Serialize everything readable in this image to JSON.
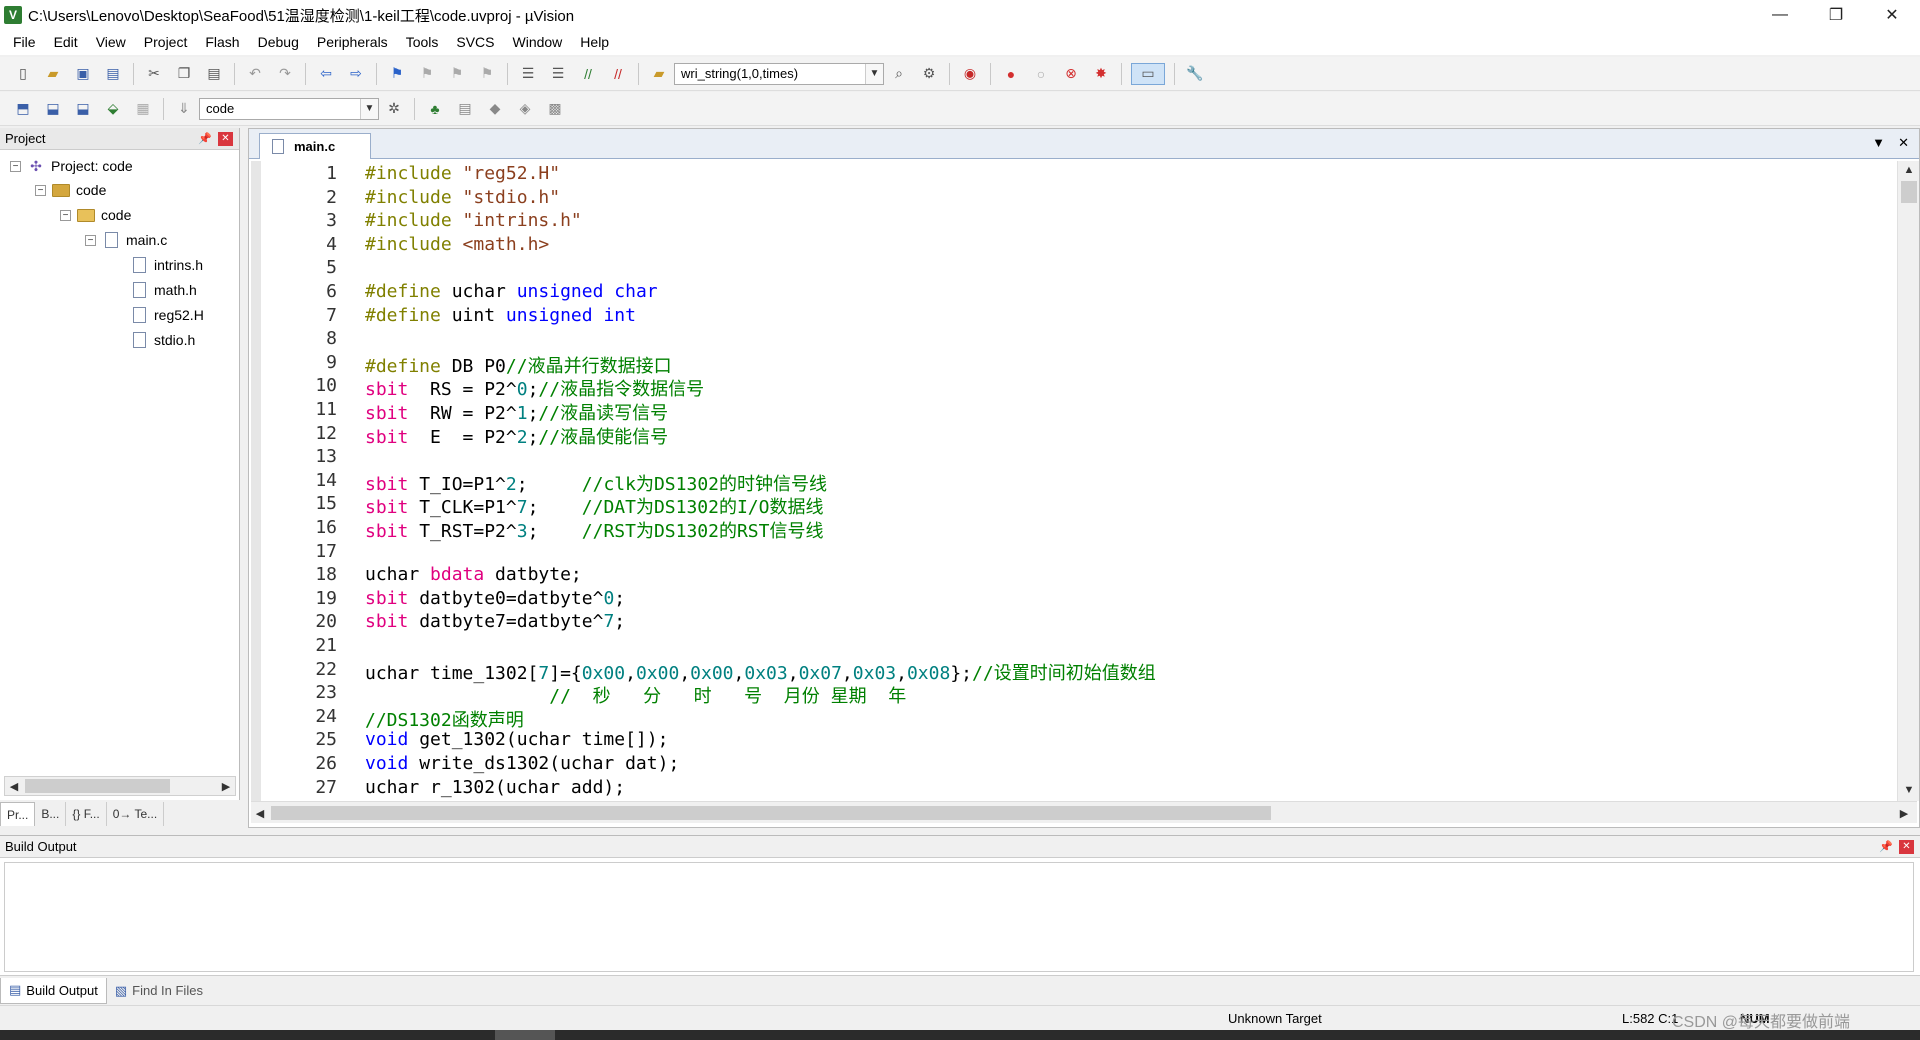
{
  "window": {
    "title": "C:\\Users\\Lenovo\\Desktop\\SeaFood\\51温湿度检测\\1-keil工程\\code.uvproj - µVision",
    "app_icon_letter": "V",
    "minimize": "—",
    "restore": "❐",
    "close": "✕"
  },
  "menu": [
    "File",
    "Edit",
    "View",
    "Project",
    "Flash",
    "Debug",
    "Peripherals",
    "Tools",
    "SVCS",
    "Window",
    "Help"
  ],
  "toolbar": {
    "find_combo_value": "wri_string(1,0,times)",
    "target_combo_value": "code"
  },
  "project_panel": {
    "title": "Project",
    "tree": [
      {
        "label": "Project: code",
        "icon": "project-icon"
      },
      {
        "label": "code",
        "icon": "target-icon"
      },
      {
        "label": "code",
        "icon": "folder-icon"
      },
      {
        "label": "main.c",
        "icon": "file-icon"
      },
      {
        "label": "intrins.h",
        "icon": "file-icon"
      },
      {
        "label": "math.h",
        "icon": "file-icon"
      },
      {
        "label": "reg52.H",
        "icon": "file-icon"
      },
      {
        "label": "stdio.h",
        "icon": "file-icon"
      }
    ],
    "tabs": [
      "Pr...",
      "B...",
      "{} F...",
      "0→ Te..."
    ]
  },
  "editor": {
    "tab_label": "main.c",
    "lines": [
      {
        "n": "1",
        "t": "#include \"reg52.H\""
      },
      {
        "n": "2",
        "t": "#include \"stdio.h\""
      },
      {
        "n": "3",
        "t": "#include \"intrins.h\""
      },
      {
        "n": "4",
        "t": "#include <math.h>"
      },
      {
        "n": "5",
        "t": ""
      },
      {
        "n": "6",
        "t": "#define uchar unsigned char"
      },
      {
        "n": "7",
        "t": "#define uint unsigned int"
      },
      {
        "n": "8",
        "t": ""
      },
      {
        "n": "9",
        "t": "#define DB P0//液晶并行数据接口"
      },
      {
        "n": "10",
        "t": "sbit  RS = P2^0;//液晶指令数据信号"
      },
      {
        "n": "11",
        "t": "sbit  RW = P2^1;//液晶读写信号"
      },
      {
        "n": "12",
        "t": "sbit  E  = P2^2;//液晶使能信号"
      },
      {
        "n": "13",
        "t": ""
      },
      {
        "n": "14",
        "t": "sbit T_IO=P1^2;     //clk为DS1302的时钟信号线"
      },
      {
        "n": "15",
        "t": "sbit T_CLK=P1^7;    //DAT为DS1302的I/O数据线"
      },
      {
        "n": "16",
        "t": "sbit T_RST=P2^3;    //RST为DS1302的RST信号线"
      },
      {
        "n": "17",
        "t": ""
      },
      {
        "n": "18",
        "t": "uchar bdata datbyte;"
      },
      {
        "n": "19",
        "t": "sbit datbyte0=datbyte^0;"
      },
      {
        "n": "20",
        "t": "sbit datbyte7=datbyte^7;"
      },
      {
        "n": "21",
        "t": ""
      },
      {
        "n": "22",
        "t": "uchar time_1302[7]={0x00,0x00,0x00,0x03,0x07,0x03,0x08};//设置时间初始值数组"
      },
      {
        "n": "23",
        "t": "                 //  秒   分   时   号  月份 星期  年"
      },
      {
        "n": "24",
        "t": "//DS1302函数声明"
      },
      {
        "n": "25",
        "t": "void get_1302(uchar time[]);"
      },
      {
        "n": "26",
        "t": "void write_ds1302(uchar dat);"
      },
      {
        "n": "27",
        "t": "uchar r_1302(uchar add);"
      }
    ]
  },
  "build_output": {
    "title": "Build Output",
    "tabs": [
      "Build Output",
      "Find In Files"
    ]
  },
  "status": {
    "target": "Unknown Target",
    "position": "L:582 C:1",
    "num": "NUM",
    "watermark": "CSDN @每天都要做前端"
  },
  "colors": {
    "preprocessor": "#808000",
    "string": "#8b3f1e",
    "keyword": "#0000ff",
    "sbit_keyword": "#e0007f",
    "comment": "#008000",
    "number": "#008080"
  }
}
